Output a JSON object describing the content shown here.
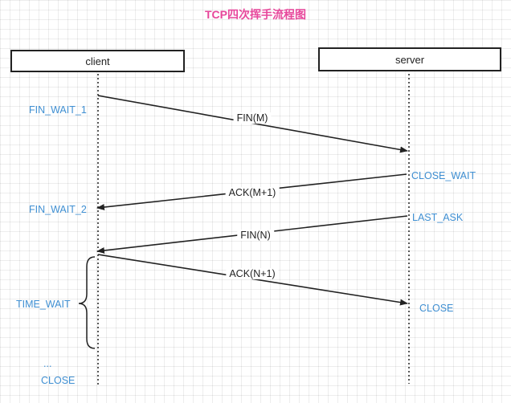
{
  "title": "TCP四次挥手流程图",
  "actors": {
    "client": "client",
    "server": "server"
  },
  "messages": [
    "FIN(M)",
    "ACK(M+1)",
    "FIN(N)",
    "ACK(N+1)"
  ],
  "client_states": [
    "FIN_WAIT_1",
    "FIN_WAIT_2",
    "TIME_WAIT",
    "...",
    "CLOSE"
  ],
  "server_states": [
    "CLOSE_WAIT",
    "LAST_ASK",
    "CLOSE"
  ],
  "colors": {
    "title": "#e7479b",
    "state": "#3f8fd2",
    "line": "#222222"
  }
}
